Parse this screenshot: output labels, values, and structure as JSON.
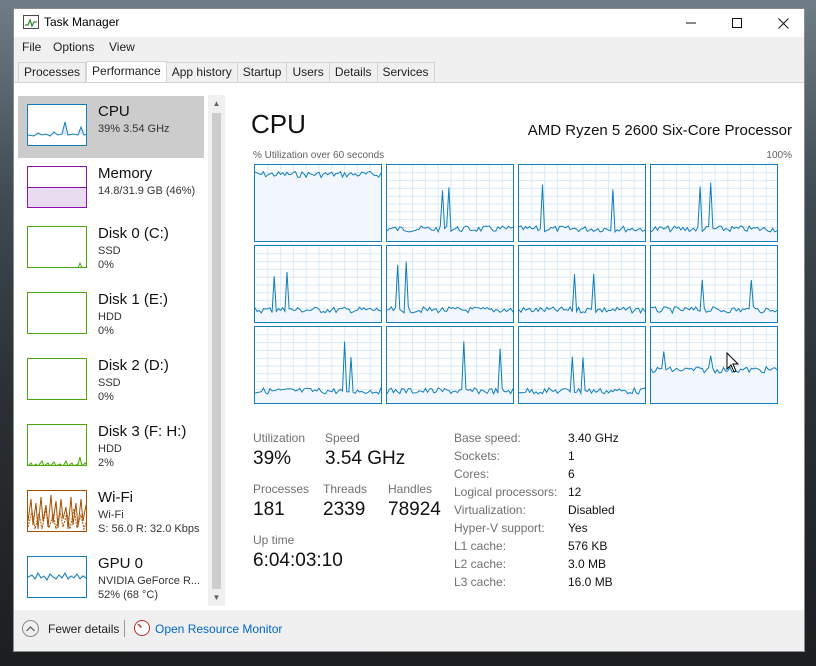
{
  "window": {
    "title": "Task Manager",
    "controls": [
      "minimize",
      "maximize",
      "close"
    ]
  },
  "menu": [
    "File",
    "Options",
    "View"
  ],
  "tabs": [
    {
      "label": "Processes",
      "active": false
    },
    {
      "label": "Performance",
      "active": true
    },
    {
      "label": "App history",
      "active": false
    },
    {
      "label": "Startup",
      "active": false
    },
    {
      "label": "Users",
      "active": false
    },
    {
      "label": "Details",
      "active": false
    },
    {
      "label": "Services",
      "active": false
    }
  ],
  "sidebar": {
    "items": [
      {
        "name": "CPU",
        "lines": [
          "39%  3.54 GHz"
        ],
        "color": "#117dbb",
        "selected": true
      },
      {
        "name": "Memory",
        "lines": [
          "14.8/31.9 GB (46%)"
        ],
        "color": "#8b12ae",
        "selected": false
      },
      {
        "name": "Disk 0 (C:)",
        "lines": [
          "SSD",
          "0%"
        ],
        "color": "#4da60c",
        "selected": false
      },
      {
        "name": "Disk 1 (E:)",
        "lines": [
          "HDD",
          "0%"
        ],
        "color": "#4da60c",
        "selected": false
      },
      {
        "name": "Disk 2 (D:)",
        "lines": [
          "SSD",
          "0%"
        ],
        "color": "#4da60c",
        "selected": false
      },
      {
        "name": "Disk 3 (F: H:)",
        "lines": [
          "HDD",
          "2%"
        ],
        "color": "#4da60c",
        "selected": false
      },
      {
        "name": "Wi-Fi",
        "lines": [
          "Wi-Fi",
          "S: 56.0  R: 32.0 Kbps"
        ],
        "color": "#a74f01",
        "selected": false
      },
      {
        "name": "GPU 0",
        "lines": [
          "NVIDIA GeForce R...",
          "52%  (68 °C)"
        ],
        "color": "#117dbb",
        "selected": false
      }
    ]
  },
  "main": {
    "heading": "CPU",
    "model": "AMD Ryzen 5 2600 Six-Core Processor",
    "graph_caption_left": "% Utilization over 60 seconds",
    "graph_caption_right": "100%",
    "graph_color": "#117dbb",
    "core_count": 12
  },
  "stats": {
    "utilization": {
      "label": "Utilization",
      "value": "39%"
    },
    "speed": {
      "label": "Speed",
      "value": "3.54 GHz"
    },
    "processes": {
      "label": "Processes",
      "value": "181"
    },
    "threads": {
      "label": "Threads",
      "value": "2339"
    },
    "handles": {
      "label": "Handles",
      "value": "78924"
    },
    "uptime": {
      "label": "Up time",
      "value": "6:04:03:10"
    }
  },
  "details": [
    {
      "label": "Base speed:",
      "value": "3.40 GHz"
    },
    {
      "label": "Sockets:",
      "value": "1"
    },
    {
      "label": "Cores:",
      "value": "6"
    },
    {
      "label": "Logical processors:",
      "value": "12"
    },
    {
      "label": "Virtualization:",
      "value": "Disabled"
    },
    {
      "label": "Hyper-V support:",
      "value": "Yes"
    },
    {
      "label": "L1 cache:",
      "value": "576 KB"
    },
    {
      "label": "L2 cache:",
      "value": "3.0 MB"
    },
    {
      "label": "L3 cache:",
      "value": "16.0 MB"
    }
  ],
  "footer": {
    "fewer_details": "Fewer details",
    "resource_monitor": "Open Resource Monitor"
  }
}
